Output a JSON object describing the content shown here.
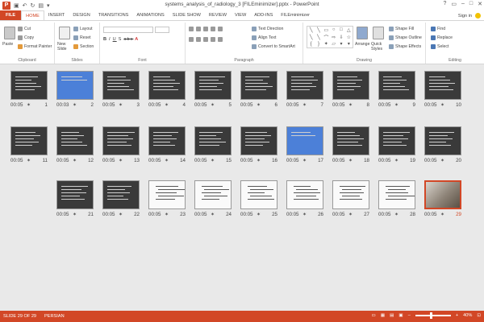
{
  "window": {
    "title": "systems_analysis_of_radiology_3 [FILEminimizer].pptx - PowerPoint",
    "app_icon": "P"
  },
  "tabs": [
    {
      "label": "FILE"
    },
    {
      "label": "HOME"
    },
    {
      "label": "INSERT"
    },
    {
      "label": "DESIGN"
    },
    {
      "label": "TRANSITIONS"
    },
    {
      "label": "ANIMATIONS"
    },
    {
      "label": "SLIDE SHOW"
    },
    {
      "label": "REVIEW"
    },
    {
      "label": "VIEW"
    },
    {
      "label": "ADD-INS"
    },
    {
      "label": "FILEminimizer"
    }
  ],
  "account": {
    "label": "Sign in"
  },
  "ribbon": {
    "clipboard": {
      "label": "Clipboard",
      "paste": "Paste",
      "cut": "Cut",
      "copy": "Copy",
      "format_painter": "Format Painter"
    },
    "slides": {
      "label": "Slides",
      "new_slide": "New Slide",
      "layout": "Layout",
      "reset": "Reset",
      "section": "Section"
    },
    "font": {
      "label": "Font"
    },
    "paragraph": {
      "label": "Paragraph",
      "text_direction": "Text Direction",
      "align_text": "Align Text",
      "smartart": "Convert to SmartArt"
    },
    "drawing": {
      "label": "Drawing",
      "arrange": "Arrange",
      "quick_styles": "Quick Styles",
      "shape_fill": "Shape Fill",
      "shape_outline": "Shape Outline",
      "shape_effects": "Shape Effects"
    },
    "editing": {
      "label": "Editing",
      "find": "Find",
      "replace": "Replace",
      "select": "Select"
    }
  },
  "slides": [
    {
      "number": "10",
      "time": "00:05",
      "style": "dark"
    },
    {
      "number": "9",
      "time": "00:05",
      "style": "dark"
    },
    {
      "number": "8",
      "time": "00:05",
      "style": "dark"
    },
    {
      "number": "7",
      "time": "00:05",
      "style": "dark"
    },
    {
      "number": "6",
      "time": "00:05",
      "style": "dark"
    },
    {
      "number": "5",
      "time": "00:05",
      "style": "dark"
    },
    {
      "number": "4",
      "time": "00:05",
      "style": "dark"
    },
    {
      "number": "3",
      "time": "00:05",
      "style": "dark"
    },
    {
      "number": "2",
      "time": "00:03",
      "style": "blue"
    },
    {
      "number": "1",
      "time": "00:05",
      "style": "dark"
    },
    {
      "number": "20",
      "time": "00:05",
      "style": "dark"
    },
    {
      "number": "19",
      "time": "00:05",
      "style": "dark"
    },
    {
      "number": "18",
      "time": "00:05",
      "style": "dark"
    },
    {
      "number": "17",
      "time": "00:05",
      "style": "blue"
    },
    {
      "number": "16",
      "time": "00:05",
      "style": "dark"
    },
    {
      "number": "15",
      "time": "00:05",
      "style": "dark"
    },
    {
      "number": "14",
      "time": "00:05",
      "style": "dark"
    },
    {
      "number": "13",
      "time": "00:05",
      "style": "dark"
    },
    {
      "number": "12",
      "time": "00:05",
      "style": "dark"
    },
    {
      "number": "11",
      "time": "00:05",
      "style": "dark"
    },
    {
      "number": "29",
      "time": "00:05",
      "style": "photo",
      "selected": true
    },
    {
      "number": "28",
      "time": "00:05",
      "style": "white"
    },
    {
      "number": "27",
      "time": "00:05",
      "style": "white"
    },
    {
      "number": "26",
      "time": "00:05",
      "style": "white"
    },
    {
      "number": "25",
      "time": "00:05",
      "style": "white"
    },
    {
      "number": "24",
      "time": "00:05",
      "style": "white"
    },
    {
      "number": "23",
      "time": "00:05",
      "style": "white"
    },
    {
      "number": "22",
      "time": "00:05",
      "style": "dark"
    },
    {
      "number": "21",
      "time": "00:05",
      "style": "dark"
    }
  ],
  "status": {
    "slide_info": "SLIDE 29 OF 29",
    "language": "PERSIAN",
    "zoom": "40%",
    "zoom_fraction": 0.4
  },
  "colors": {
    "accent": "#d24726",
    "sorter_bg": "#e9e9e9"
  }
}
